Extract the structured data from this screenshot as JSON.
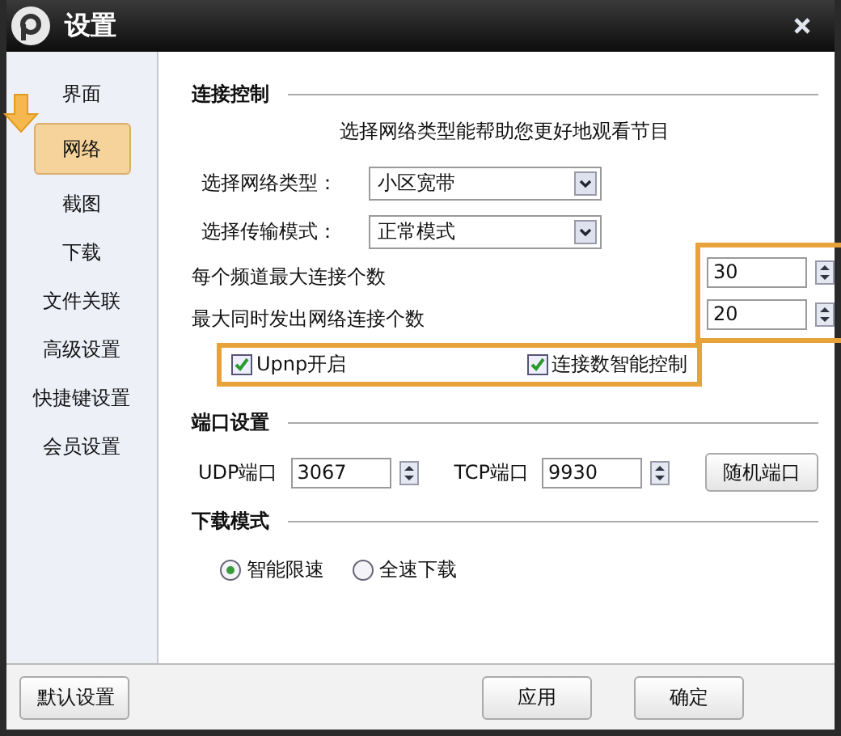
{
  "window": {
    "title": "设置"
  },
  "sidebar": {
    "items": [
      {
        "label": "界面",
        "selected": false
      },
      {
        "label": "网络",
        "selected": true
      },
      {
        "label": "截图",
        "selected": false
      },
      {
        "label": "下载",
        "selected": false
      },
      {
        "label": "文件关联",
        "selected": false
      },
      {
        "label": "高级设置",
        "selected": false
      },
      {
        "label": "快捷键设置",
        "selected": false
      },
      {
        "label": "会员设置",
        "selected": false
      }
    ]
  },
  "connection": {
    "heading": "连接控制",
    "hint": "选择网络类型能帮助您更好地观看节目",
    "selects": [
      {
        "label": "选择网络类型：",
        "value": "小区宽带"
      },
      {
        "label": "选择传输模式：",
        "value": "正常模式"
      }
    ],
    "spinners": [
      {
        "label": "每个频道最大连接个数",
        "value": "30"
      },
      {
        "label": "最大同时发出网络连接个数",
        "value": "20"
      }
    ],
    "checkboxes": [
      {
        "label": "Upnp开启",
        "checked": true
      },
      {
        "label": "连接数智能控制",
        "checked": true
      }
    ]
  },
  "ports": {
    "heading": "端口设置",
    "fields": [
      {
        "label": "UDP端口",
        "value": "3067"
      },
      {
        "label": "TCP端口",
        "value": "9930"
      }
    ],
    "button": "随机端口"
  },
  "download": {
    "heading": "下载模式",
    "options": [
      {
        "label": "智能限速",
        "selected": true
      },
      {
        "label": "全速下载",
        "selected": false
      }
    ]
  },
  "footer": {
    "left_button": "默认设置",
    "buttons": [
      "应用",
      "确定"
    ]
  }
}
